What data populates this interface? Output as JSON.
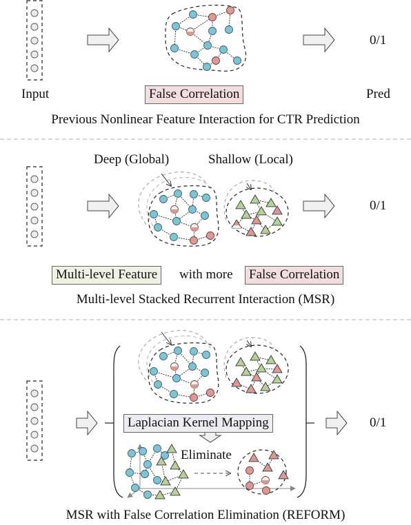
{
  "colors": {
    "node_blue": "#7fc4d4",
    "node_red": "#d99a96",
    "node_green": "#b7cf9a",
    "input_node": "#ebebeb",
    "false_corr_bg": "#f2dede",
    "multi_level_bg": "#eef2e4",
    "laplacian_bg": "#ececf2",
    "separator": "#cccccc"
  },
  "panel1": {
    "input_label": "Input",
    "false_correlation_tag": "False Correlation",
    "output_value": "0/1",
    "pred_label": "Pred",
    "caption": "Previous Nonlinear Feature Interaction for CTR Prediction"
  },
  "panel2": {
    "deep_label": "Deep (Global)",
    "shallow_label": "Shallow (Local)",
    "output_value": "0/1",
    "multi_level_tag": "Multi-level Feature",
    "with_more_text": "with more",
    "false_correlation_tag": "False Correlation",
    "caption": "Multi-level Stacked Recurrent Interaction (MSR)"
  },
  "panel3": {
    "laplacian_tag": "Laplacian Kernel Mapping",
    "eliminate_label": "Eliminate",
    "output_value": "0/1",
    "caption": "MSR with False Correlation Elimination (REFORM)"
  },
  "icons": {
    "input_vector": "input-vector-icon",
    "block_arrow": "right-arrow-icon",
    "graph": "graph-icon",
    "recurrent_arrow": "recurrent-arrow-icon"
  }
}
